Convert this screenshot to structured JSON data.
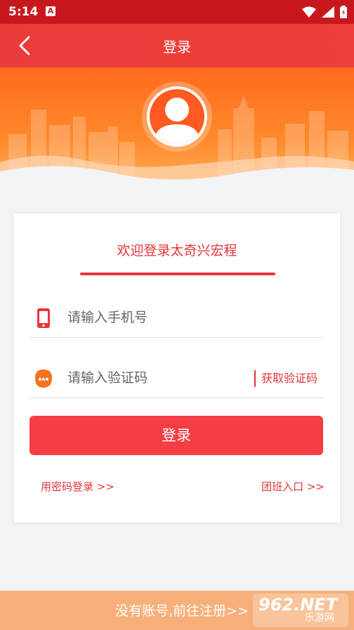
{
  "status": {
    "time": "5:14",
    "notif_letter": "A"
  },
  "header": {
    "title": "登录",
    "back_icon": "chevron-left-icon"
  },
  "card": {
    "welcome": "欢迎登录太奇兴宏程",
    "phone_placeholder": "请输入手机号",
    "code_placeholder": "请输入验证码",
    "get_code": "获取验证码",
    "login_label": "登录",
    "password_login": "用密码登录 >>",
    "group_entry": "团班入口 >>"
  },
  "footer": {
    "register": "没有账号,前往注册>>"
  },
  "watermark": {
    "big": "962.NET",
    "small": "乐游网"
  },
  "colors": {
    "primary": "#e3353a",
    "button": "#f53d44",
    "banner": "#ff6a1c",
    "footer": "#f7b07a"
  }
}
